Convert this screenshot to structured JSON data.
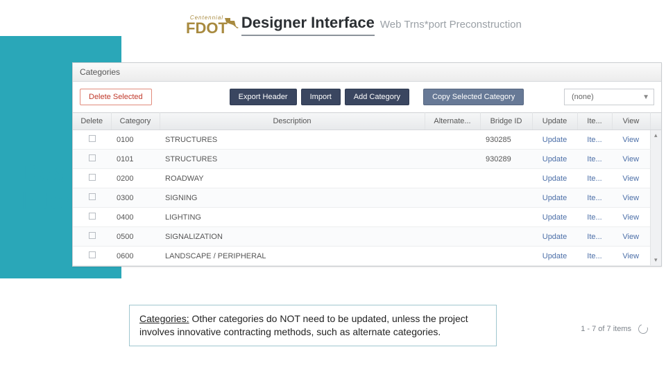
{
  "header": {
    "logo_top": "Centennial",
    "logo_main": "FDOT",
    "title": "Designer Interface",
    "subtitle": "Web Trns*port Preconstruction"
  },
  "bg_title_line1": "Designer",
  "bg_title_line2": "Interface",
  "panel": {
    "title": "Categories",
    "buttons": {
      "delete_selected": "Delete Selected",
      "export_header": "Export Header",
      "import": "Import",
      "add_category": "Add Category",
      "copy_selected": "Copy Selected Category"
    },
    "select_placeholder": "(none)",
    "columns": {
      "delete": "Delete",
      "category": "Category",
      "description": "Description",
      "alternate": "Alternate...",
      "bridge_id": "Bridge ID",
      "update": "Update",
      "items": "Ite...",
      "view": "View"
    },
    "rows": [
      {
        "category": "0100",
        "description": "STRUCTURES",
        "bridge_id": "930285",
        "update": "Update",
        "items": "Ite...",
        "view": "View"
      },
      {
        "category": "0101",
        "description": "STRUCTURES",
        "bridge_id": "930289",
        "update": "Update",
        "items": "Ite...",
        "view": "View"
      },
      {
        "category": "0200",
        "description": "ROADWAY",
        "bridge_id": "",
        "update": "Update",
        "items": "Ite...",
        "view": "View"
      },
      {
        "category": "0300",
        "description": "SIGNING",
        "bridge_id": "",
        "update": "Update",
        "items": "Ite...",
        "view": "View"
      },
      {
        "category": "0400",
        "description": "LIGHTING",
        "bridge_id": "",
        "update": "Update",
        "items": "Ite...",
        "view": "View"
      },
      {
        "category": "0500",
        "description": "SIGNALIZATION",
        "bridge_id": "",
        "update": "Update",
        "items": "Ite...",
        "view": "View"
      },
      {
        "category": "0600",
        "description": "LANDSCAPE / PERIPHERAL",
        "bridge_id": "",
        "update": "Update",
        "items": "Ite...",
        "view": "View"
      }
    ]
  },
  "footer_count": "1 - 7 of 7 items",
  "note": {
    "label": "Categories:",
    "body": " Other categories do NOT need to be updated, unless the project involves innovative contracting methods, such as alternate categories."
  }
}
